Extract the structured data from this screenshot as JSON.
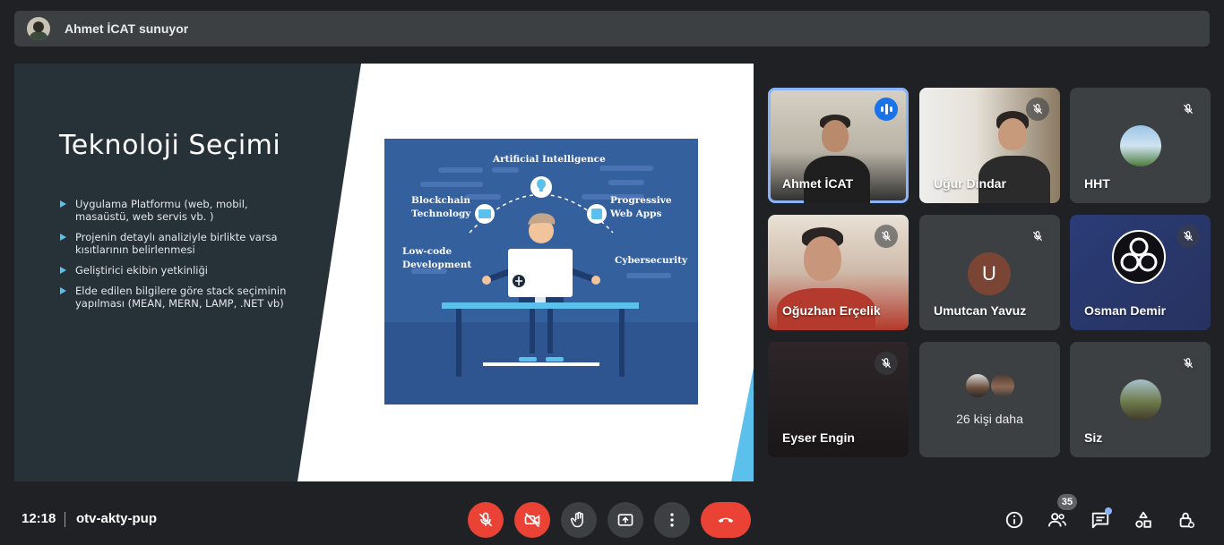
{
  "presenter_banner": {
    "text": "Ahmet İCAT sunuyor"
  },
  "slide": {
    "title": "Teknoloji Seçimi",
    "bullets": [
      "Uygulama Platformu (web, mobil, masaüstü, web servis vb. )",
      "Projenin detaylı analiziyle birlikte varsa kısıtlarının belirlenmesi",
      "Geliştirici ekibin yetkinliği",
      "Elde edilen bilgilere göre stack seçiminin yapılması (MEAN, MERN, LAMP, .NET vb)"
    ],
    "illustration": {
      "labels": {
        "ai": "Artificial Intelligence",
        "blockchain": "Blockchain Technology",
        "pwa": "Progressive Web Apps",
        "lowcode": "Low-code Development",
        "cyber": "Cybersecurity"
      }
    }
  },
  "participants": {
    "tiles": [
      {
        "name": "Ahmet İCAT",
        "state": "speaking",
        "icon": "audio-level-icon"
      },
      {
        "name": "Uğur Dindar",
        "state": "muted",
        "icon": "mic-off-icon"
      },
      {
        "name": "HHT",
        "state": "muted",
        "icon": "mic-off-icon"
      },
      {
        "name": "Oğuzhan Erçelik",
        "state": "muted",
        "icon": "mic-off-icon"
      },
      {
        "name": "Umutcan Yavuz",
        "state": "muted",
        "icon": "mic-off-icon",
        "initial": "U"
      },
      {
        "name": "Osman Demir",
        "state": "muted",
        "icon": "mic-off-icon"
      },
      {
        "name": "Eyser Engin",
        "state": "muted",
        "icon": "mic-off-icon"
      },
      {
        "more_label": "26 kişi daha"
      },
      {
        "name": "Siz",
        "state": "muted",
        "icon": "mic-off-icon"
      }
    ]
  },
  "bottom_bar": {
    "time": "12:18",
    "meeting_code": "otv-akty-pup",
    "controls": [
      "mic-off-icon",
      "camera-off-icon",
      "hand-icon",
      "present-icon",
      "more-vert-icon",
      "call-end-icon"
    ],
    "right": {
      "people_count": "35",
      "icons": [
        "info-icon",
        "people-icon",
        "chat-icon",
        "activities-icon",
        "host-controls-icon"
      ]
    }
  },
  "colors": {
    "background": "#202124",
    "surface": "#3c4043",
    "danger": "#ea4335",
    "accent": "#8ab4f8",
    "slide_dark": "#263238",
    "slide_accent": "#5bc0eb"
  }
}
